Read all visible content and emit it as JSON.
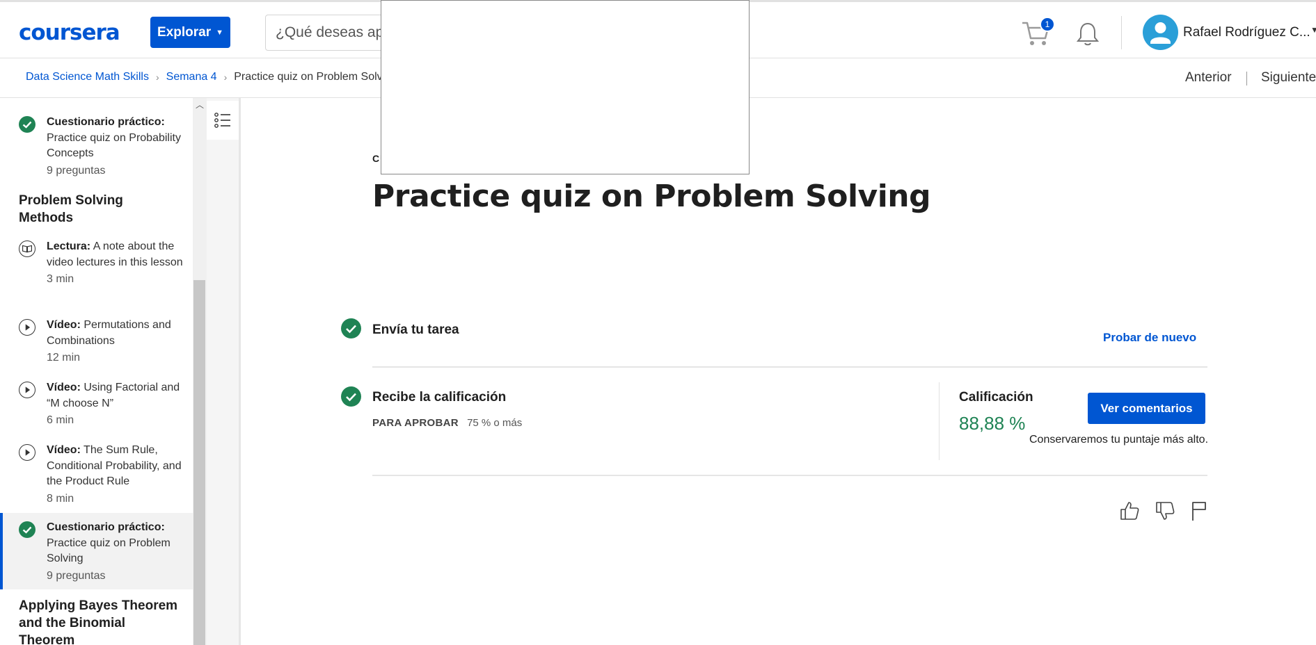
{
  "header": {
    "logo_text": "coursera",
    "explore_label": "Explorar",
    "search_placeholder": "¿Qué deseas apr",
    "cart_count": "1",
    "user_name": "Rafael Rodríguez C..."
  },
  "breadcrumb": {
    "items": [
      "Data Science Math Skills",
      "Semana 4"
    ],
    "current": "Practice quiz on Problem Solving"
  },
  "nav": {
    "prev_label": "Anterior",
    "next_label": "Siguiente"
  },
  "sidebar": {
    "items": [
      {
        "type": "Cuestionario práctico:",
        "title": "Practice quiz on Probability Concepts",
        "meta": "9 preguntas",
        "icon": "check-circle-icon"
      },
      {
        "type": "Lectura:",
        "title": "A note about the video lectures in this lesson",
        "meta": "3 min",
        "icon": "book-icon"
      },
      {
        "type": "Vídeo:",
        "title": "Permutations and Combinations",
        "meta": "12 min",
        "icon": "play-circle-icon"
      },
      {
        "type": "Vídeo:",
        "title": "Using Factorial and “M choose N”",
        "meta": "6 min",
        "icon": "play-circle-icon"
      },
      {
        "type": "Vídeo:",
        "title": "The Sum Rule, Conditional Probability, and the Product Rule",
        "meta": "8 min",
        "icon": "play-circle-icon"
      },
      {
        "type": "Cuestionario práctico:",
        "title": "Practice quiz on Problem Solving",
        "meta": "9 preguntas",
        "icon": "check-circle-icon"
      }
    ],
    "sections": [
      "Problem Solving Methods",
      "Applying Bayes Theorem and the Binomial Theorem"
    ]
  },
  "main": {
    "kind_label": "CU",
    "title": "Practice quiz on Problem Solving",
    "step1_title": "Envía tu tarea",
    "retry_label": "Probar de nuevo",
    "step2_title": "Recibe la calificación",
    "pass_label": "PARA APROBAR",
    "pass_value": "75 % o más",
    "grade_label": "Calificación",
    "grade_value": "88,88 %",
    "feedback_label": "Ver comentarios",
    "keep_note": "Conservaremos tu puntaje más alto."
  },
  "colors": {
    "brand_blue": "#0056d2",
    "success_green": "#1f8354",
    "avatar_blue": "#2a9fd8"
  }
}
